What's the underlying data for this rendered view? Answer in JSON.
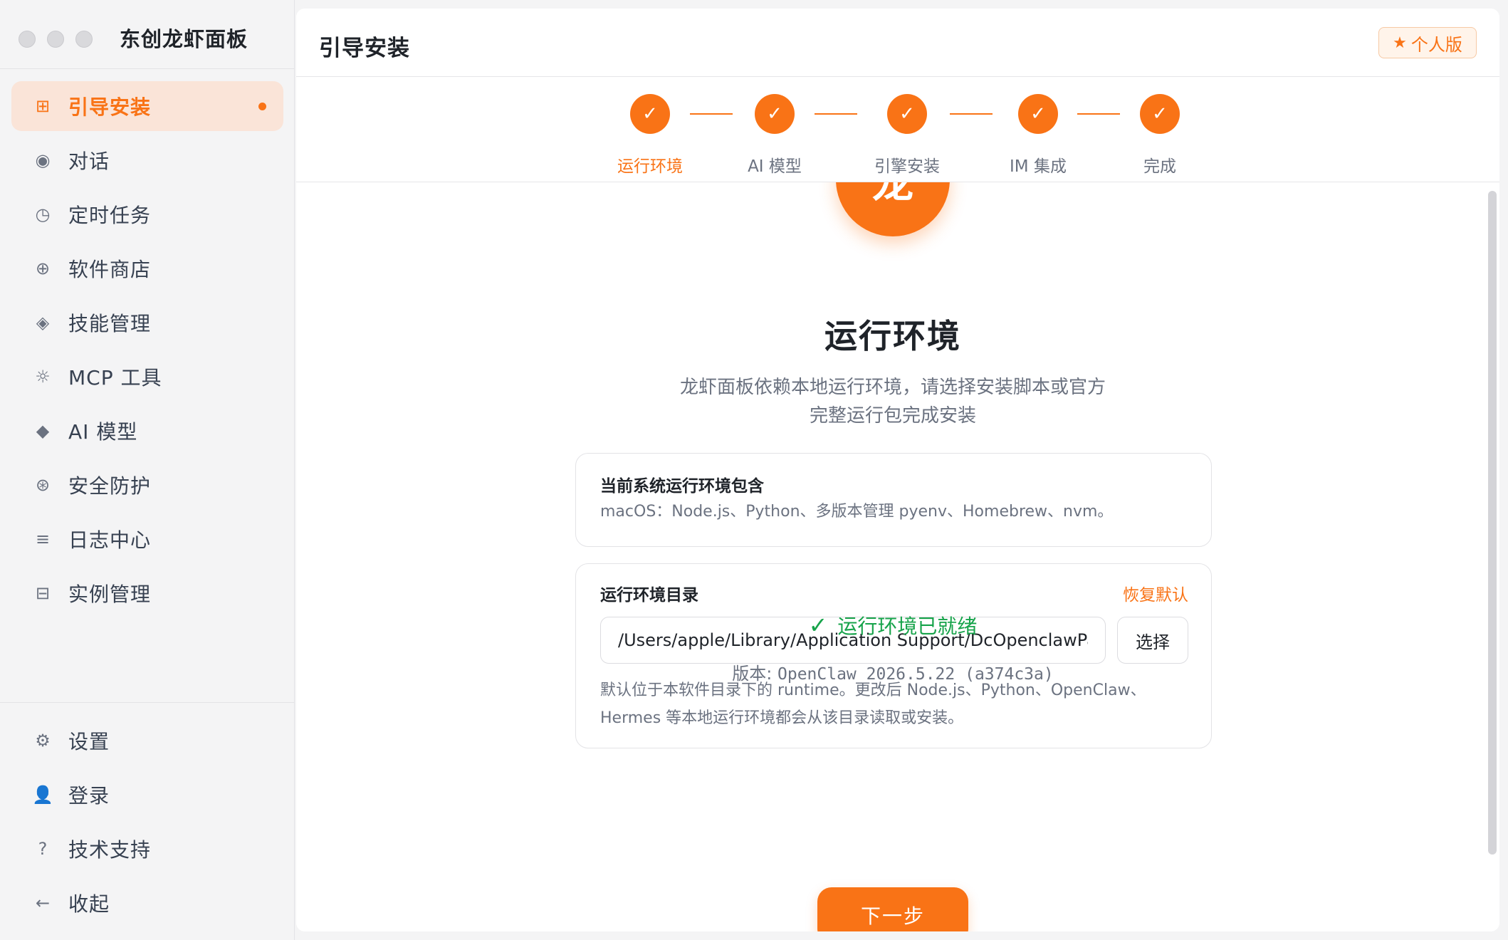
{
  "app": {
    "title": "东创龙虾面板"
  },
  "sidebar": {
    "items": [
      {
        "label": "引导安装",
        "icon": "grid-icon",
        "glyph": "⊞",
        "active": true
      },
      {
        "label": "对话",
        "icon": "chat-icon",
        "glyph": "◉"
      },
      {
        "label": "定时任务",
        "icon": "clock-icon",
        "glyph": "◷"
      },
      {
        "label": "软件商店",
        "icon": "plus-circle-icon",
        "glyph": "⊕"
      },
      {
        "label": "技能管理",
        "icon": "diamond-outline-icon",
        "glyph": "◈"
      },
      {
        "label": "MCP 工具",
        "icon": "sun-gear-icon",
        "glyph": "☼"
      },
      {
        "label": "AI 模型",
        "icon": "diamond-icon",
        "glyph": "◆"
      },
      {
        "label": "安全防护",
        "icon": "shield-icon",
        "glyph": "⊛"
      },
      {
        "label": "日志中心",
        "icon": "list-icon",
        "glyph": "≡"
      },
      {
        "label": "实例管理",
        "icon": "instance-icon",
        "glyph": "⊟"
      }
    ],
    "footer_items": [
      {
        "label": "设置",
        "icon": "gear-icon",
        "glyph": "⚙"
      },
      {
        "label": "登录",
        "icon": "user-icon",
        "glyph": "👤"
      },
      {
        "label": "技术支持",
        "icon": "help-icon",
        "glyph": "?"
      },
      {
        "label": "收起",
        "icon": "arrow-left-icon",
        "glyph": "←"
      }
    ]
  },
  "header": {
    "title": "引导安装",
    "badge": "个人版",
    "badge_icon": "★"
  },
  "stepper": {
    "check_glyph": "✓",
    "steps": [
      {
        "label": "运行环境",
        "done": true,
        "current": true
      },
      {
        "label": "AI 模型",
        "done": true
      },
      {
        "label": "引擎安装",
        "done": true
      },
      {
        "label": "IM 集成",
        "done": true
      },
      {
        "label": "完成",
        "done": true
      }
    ]
  },
  "content": {
    "logo_char": "龙",
    "title": "运行环境",
    "description": "龙虾面板依赖本地运行环境，请选择安装脚本或官方完整运行包完成安装",
    "env_card": {
      "title": "当前系统运行环境包含",
      "text": "macOS：Node.js、Python、多版本管理 pyenv、Homebrew、nvm。"
    },
    "dir_card": {
      "title": "运行环境目录",
      "reset_label": "恢复默认",
      "path_value": "/Users/apple/Library/Application Support/DcOpenclawPanel",
      "choose_label": "选择",
      "hint_line1": "默认位于本软件目录下的 runtime。更改后 Node.js、Python、OpenClaw、",
      "hint_line2": "Hermes 等本地运行环境都会从该目录读取或安装。"
    },
    "status": {
      "check_glyph": "✓",
      "text": "运行环境已就绪"
    },
    "version": {
      "label": "版本:",
      "value": "OpenClaw 2026.5.22 (a374c3a)"
    },
    "next_label": "下一步"
  },
  "colors": {
    "accent": "#f97316",
    "success": "#16a34a",
    "active_nav_bg": "#fae4d8"
  }
}
